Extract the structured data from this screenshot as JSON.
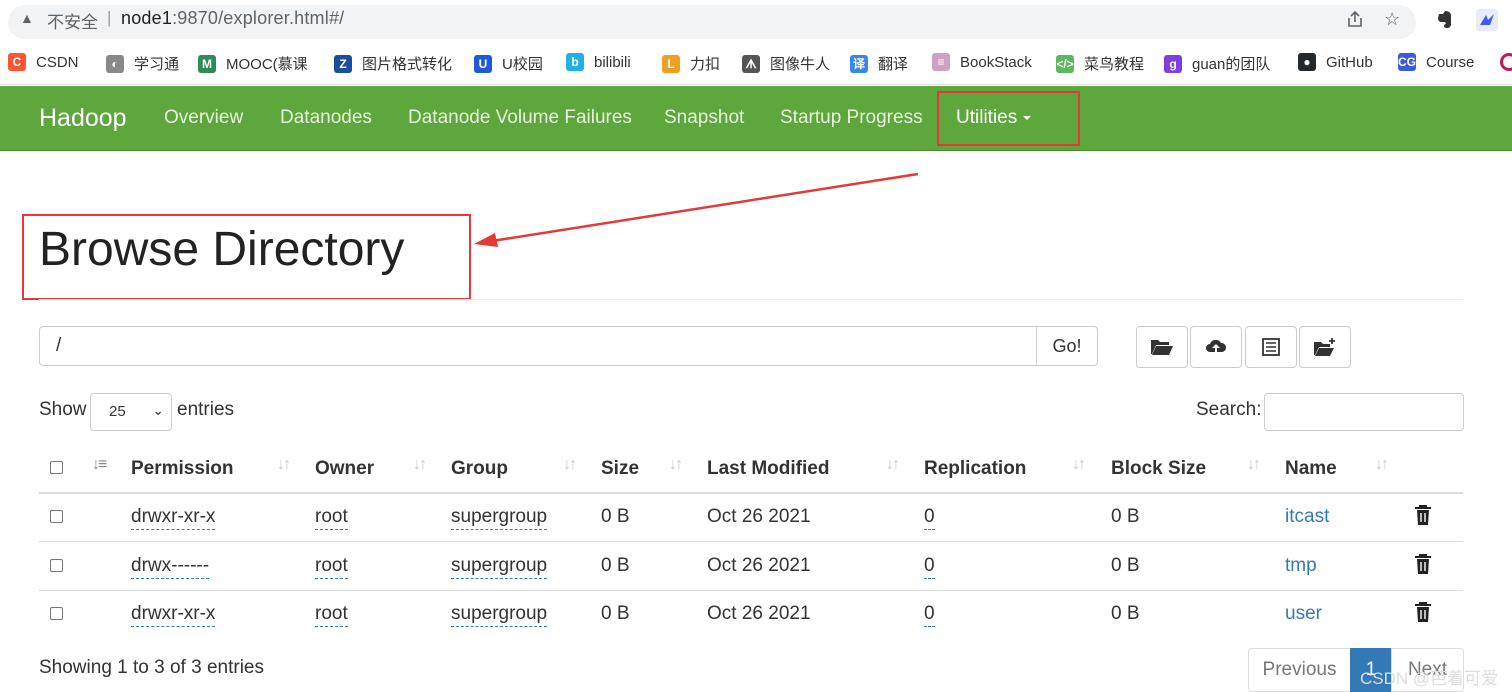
{
  "browser": {
    "insecure_label": "不安全",
    "separator": "|",
    "url_host": "node1",
    "url_path": ":9870/explorer.html#/",
    "bookmarks": [
      {
        "label": "CSDN",
        "color": "#fc5531",
        "glyph": "C"
      },
      {
        "label": "学习通",
        "color": "#888888",
        "glyph": "◐"
      },
      {
        "label": "MOOC(慕课",
        "color": "#2e8b57",
        "glyph": "M"
      },
      {
        "label": "图片格式转化",
        "color": "#1a4fa0",
        "glyph": "Z"
      },
      {
        "label": "U校园",
        "color": "#1e5bd8",
        "glyph": "U"
      },
      {
        "label": "bilibili",
        "color": "#20b0e3",
        "glyph": "b"
      },
      {
        "label": "力扣",
        "color": "#f0a020",
        "glyph": "L"
      },
      {
        "label": "图像牛人",
        "color": "#555555",
        "glyph": "ᗑ"
      },
      {
        "label": "翻译",
        "color": "#3a86f0",
        "glyph": "译"
      },
      {
        "label": "BookStack",
        "color": "#d0a0c0",
        "glyph": "≡"
      },
      {
        "label": "菜鸟教程",
        "color": "#5cb85c",
        "glyph": "</>"
      },
      {
        "label": "guan的团队",
        "color": "#7b3fe4",
        "glyph": "g"
      },
      {
        "label": "GitHub",
        "color": "#24292e",
        "glyph": "●"
      },
      {
        "label": "Course",
        "color": "#3b5bdb",
        "glyph": "CG"
      }
    ]
  },
  "navbar": {
    "brand": "Hadoop",
    "items": [
      "Overview",
      "Datanodes",
      "Datanode Volume Failures",
      "Snapshot",
      "Startup Progress",
      "Utilities"
    ]
  },
  "main": {
    "title": "Browse Directory",
    "path_value": "/",
    "go_label": "Go!",
    "show_label": "Show",
    "entries_label": "entries",
    "page_length": "25",
    "search_label": "Search:"
  },
  "table": {
    "columns": [
      "Permission",
      "Owner",
      "Group",
      "Size",
      "Last Modified",
      "Replication",
      "Block Size",
      "Name"
    ],
    "rows": [
      {
        "permission": "drwxr-xr-x",
        "owner": "root",
        "group": "supergroup",
        "size": "0 B",
        "modified": "Oct 26 2021",
        "replication": "0",
        "block_size": "0 B",
        "name": "itcast"
      },
      {
        "permission": "drwx------",
        "owner": "root",
        "group": "supergroup",
        "size": "0 B",
        "modified": "Oct 26 2021",
        "replication": "0",
        "block_size": "0 B",
        "name": "tmp"
      },
      {
        "permission": "drwxr-xr-x",
        "owner": "root",
        "group": "supergroup",
        "size": "0 B",
        "modified": "Oct 26 2021",
        "replication": "0",
        "block_size": "0 B",
        "name": "user"
      }
    ]
  },
  "footer": {
    "info": "Showing 1 to 3 of 3 entries",
    "previous": "Previous",
    "current_page": "1",
    "next": "Next"
  },
  "watermark": "CSDN @芭着可爱",
  "colors": {
    "navbar": "#5ea73c",
    "link": "#337ab7",
    "annotation": "#e53935",
    "active_page": "#337ab7"
  }
}
